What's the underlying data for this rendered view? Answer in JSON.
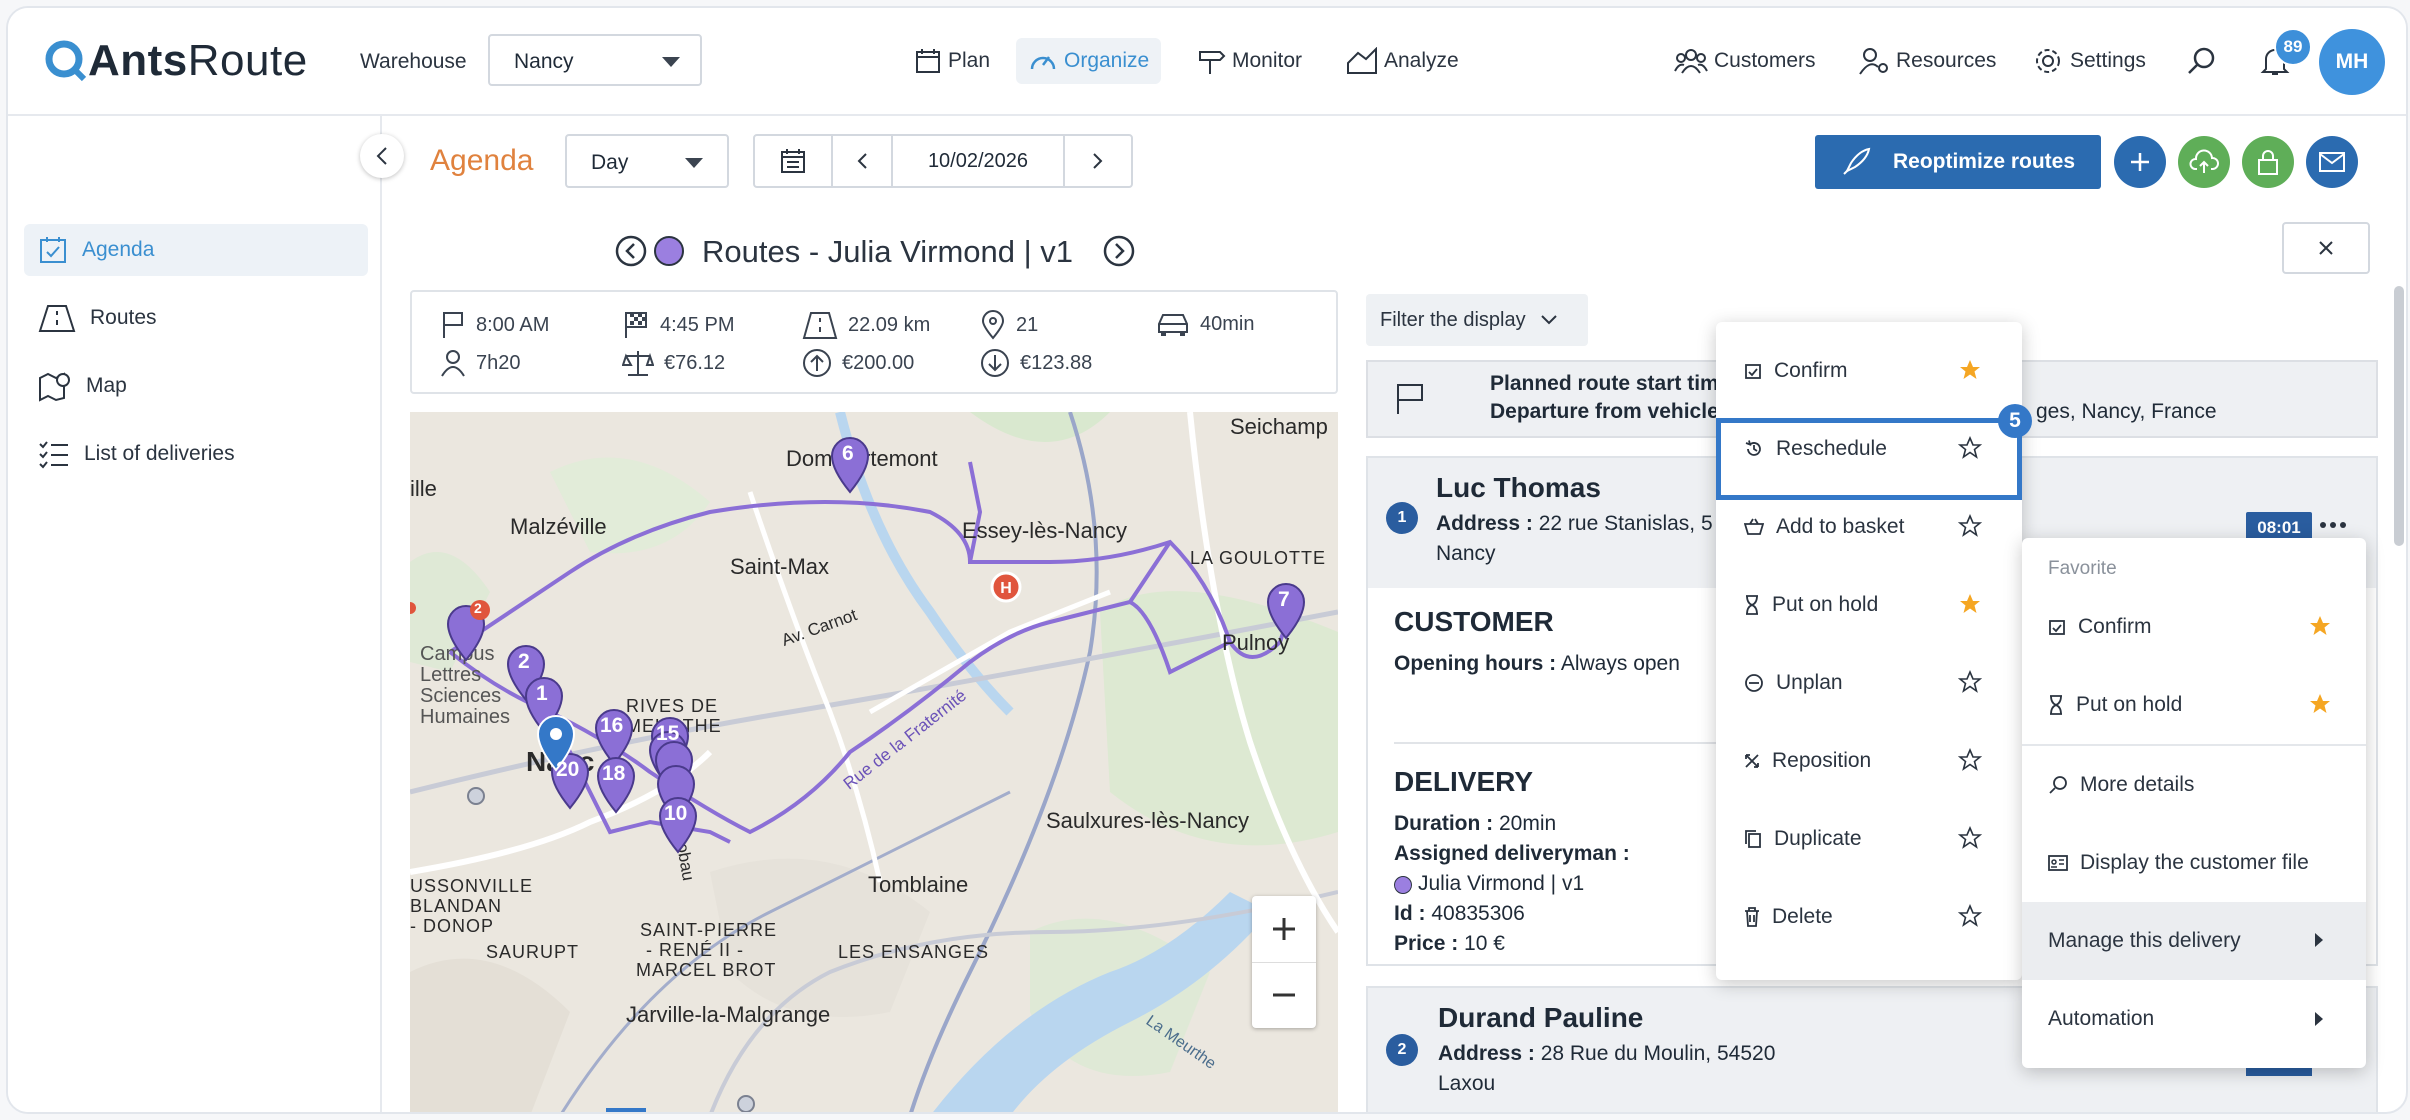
{
  "app": {
    "logo_ants": "Ants",
    "logo_route": "Route"
  },
  "header": {
    "warehouse_label": "Warehouse",
    "warehouse_value": "Nancy",
    "nav": {
      "plan": "Plan",
      "organize": "Organize",
      "monitor": "Monitor",
      "analyze": "Analyze"
    },
    "right": {
      "customers": "Customers",
      "resources": "Resources",
      "settings": "Settings"
    },
    "notifications_count": "89",
    "avatar_initials": "MH"
  },
  "sidebar": {
    "items": [
      {
        "label": "Agenda"
      },
      {
        "label": "Routes"
      },
      {
        "label": "Map"
      },
      {
        "label": "List of deliveries"
      }
    ]
  },
  "toolbar": {
    "title": "Agenda",
    "view_value": "Day",
    "date": "10/02/2026",
    "reoptimize_label": "Reoptimize routes"
  },
  "route": {
    "title": "Routes - Julia Virmond | v1",
    "stats": {
      "start": "8:00 AM",
      "end": "4:45 PM",
      "distance": "22.09 km",
      "stops": "21",
      "vehicle_time": "40min",
      "duration": "7h20",
      "cost": "€76.12",
      "up_amount": "€200.00",
      "down_amount": "€123.88"
    }
  },
  "map": {
    "places": [
      "Seichamp",
      "Dommartemont",
      "ille",
      "Malzéville",
      "Saint-Max",
      "Essey-lès-Nancy",
      "LA GOULOTTE",
      "Pulnoy",
      "Campus Lettres Sciences Humaines",
      "RIVES DE MEURTHE",
      "Av. Carnot",
      "Rue de la Fraternité",
      "Saulxures-lès-Nancy",
      "Tomblaine",
      "USSONVILLE",
      "BLANDAN",
      "- DONOP",
      "SAURUPT",
      "SAINT-PIERRE",
      "- RENÉ II -",
      "MARCEL BROT",
      "LES ENSANGES",
      "Jarville-la-Malgrange",
      "La Meurthe",
      "Nanc",
      "obau"
    ],
    "pins": [
      "6",
      "7",
      "2",
      "1",
      "16",
      "15",
      "20",
      "18",
      "10",
      "2"
    ]
  },
  "panel": {
    "filter_label": "Filter the display",
    "start_line1": "Planned route start tim",
    "start_line2": "Departure from vehicle",
    "start_line2_rest": "ges, Nancy, France",
    "card1": {
      "number": "1",
      "name": "Luc Thomas",
      "address_label": "Address :",
      "address": "22 rue Stanislas, 5",
      "city": "Nancy",
      "time": "08:01",
      "customer_title": "CUSTOMER",
      "opening_label": "Opening hours :",
      "opening_value": "Always open",
      "delivery_title": "DELIVERY",
      "duration_label": "Duration :",
      "duration_value": "20min",
      "deliveryman_label": "Assigned deliveryman :",
      "deliveryman_value": "Julia Virmond | v1",
      "id_label": "Id :",
      "id_value": "40835306",
      "price_label": "Price :",
      "price_value": "10 €"
    },
    "card2": {
      "number": "2",
      "name": "Durand Pauline",
      "address_label": "Address :",
      "address": "28 Rue du Moulin, 54520",
      "city": "Laxou"
    }
  },
  "manage_menu": {
    "items": [
      {
        "label": "Confirm",
        "icon": "confirm-icon",
        "favorite": true
      },
      {
        "label": "Reschedule",
        "icon": "history-icon",
        "favorite": false
      },
      {
        "label": "Add to basket",
        "icon": "basket-icon",
        "favorite": false
      },
      {
        "label": "Put on hold",
        "icon": "hourglass-icon",
        "favorite": true
      },
      {
        "label": "Unplan",
        "icon": "minus-circle-icon",
        "favorite": false
      },
      {
        "label": "Reposition",
        "icon": "reposition-icon",
        "favorite": false
      },
      {
        "label": "Duplicate",
        "icon": "duplicate-icon",
        "favorite": false
      },
      {
        "label": "Delete",
        "icon": "trash-icon",
        "favorite": false
      }
    ],
    "step_badge": "5"
  },
  "context_menu": {
    "favorite_header": "Favorite",
    "confirm": "Confirm",
    "put_on_hold": "Put on hold",
    "more_details": "More details",
    "customer_file": "Display the customer file",
    "manage": "Manage this delivery",
    "automation": "Automation"
  },
  "colors": {
    "accent": "#3a8fd0",
    "primary_dark": "#2b6bb0",
    "orange": "#e0823e",
    "route_purple": "#8b6fd6",
    "star": "#f5a623"
  }
}
